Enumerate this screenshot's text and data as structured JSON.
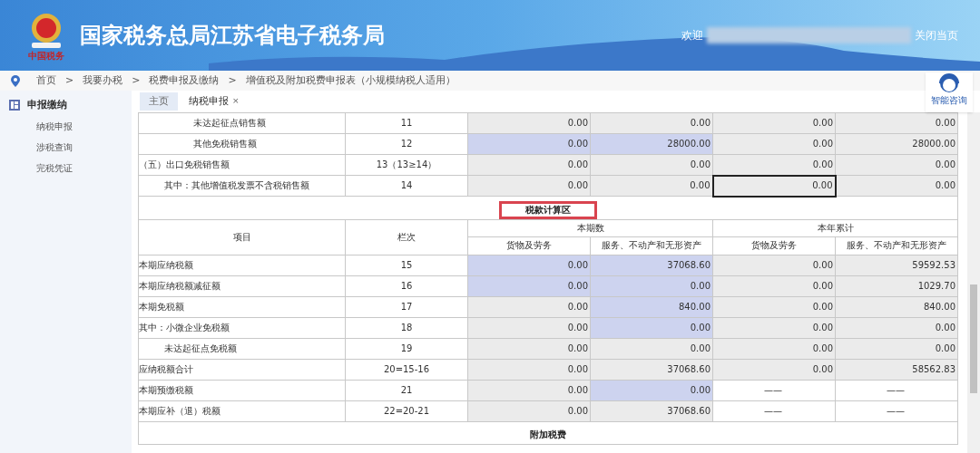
{
  "header": {
    "emblem_caption": "中国税务",
    "title": "国家税务总局江苏省电子税务局",
    "welcome": "欢迎",
    "close_page": "关闭当页"
  },
  "breadcrumb": {
    "separator": ">",
    "items": [
      "首页",
      "我要办税",
      "税费申报及缴纳",
      "增值税及附加税费申报表（小规模纳税人适用）"
    ]
  },
  "assistant": {
    "label": "智能咨询"
  },
  "sidebar": {
    "title": "申报缴纳",
    "items": [
      {
        "label": "纳税申报",
        "selected": false
      },
      {
        "label": "涉税查询",
        "selected": false
      },
      {
        "label": "完税凭证",
        "selected": false
      }
    ]
  },
  "tabs": [
    {
      "label": "主页",
      "selected": false
    },
    {
      "label": "纳税申报",
      "selected": true,
      "close": "×"
    }
  ],
  "upper_rows": [
    {
      "item": "未达起征点销售额",
      "kind": "deep",
      "line": "11",
      "cells": [
        {
          "text": "0.00",
          "kind": "computed",
          "focused": false
        },
        {
          "text": "0.00",
          "kind": "computed",
          "focused": false
        },
        {
          "text": "0.00",
          "kind": "computed",
          "focused": false
        },
        {
          "text": "0.00",
          "kind": "computed",
          "focused": false
        }
      ]
    },
    {
      "item": "其他免税销售额",
      "kind": "deep",
      "line": "12",
      "cells": [
        {
          "text": "0.00",
          "kind": "input",
          "focused": false
        },
        {
          "text": "28000.00",
          "kind": "input",
          "focused": false
        },
        {
          "text": "0.00",
          "kind": "computed",
          "focused": false
        },
        {
          "text": "28000.00",
          "kind": "computed",
          "focused": false
        }
      ]
    },
    {
      "item": "（五）出口免税销售额",
      "kind": "plain",
      "line": "13（13≥14）",
      "cells": [
        {
          "text": "0.00",
          "kind": "computed",
          "focused": false
        },
        {
          "text": "0.00",
          "kind": "computed",
          "focused": false
        },
        {
          "text": "0.00",
          "kind": "computed",
          "focused": false
        },
        {
          "text": "0.00",
          "kind": "computed",
          "focused": false
        }
      ]
    },
    {
      "item": "其中：其他增值税发票不含税销售额",
      "kind": "indent",
      "line": "14",
      "cells": [
        {
          "text": "0.00",
          "kind": "computed",
          "focused": false
        },
        {
          "text": "0.00",
          "kind": "computed",
          "focused": false
        },
        {
          "text": "0.00",
          "kind": "computed",
          "focused": true
        },
        {
          "text": "0.00",
          "kind": "computed",
          "focused": false
        }
      ]
    }
  ],
  "section": {
    "title": "税款计算区",
    "highlighted": true
  },
  "columns": {
    "item": "项目",
    "line": "栏次",
    "groups": [
      "本期数",
      "本年累计"
    ],
    "subs": [
      "货物及劳务",
      "服务、不动产和无形资产",
      "货物及劳务",
      "服务、不动产和无形资产"
    ]
  },
  "rows": [
    {
      "item": "本期应纳税额",
      "kind": "plain",
      "line": "15",
      "cells": [
        {
          "text": "0.00",
          "kind": "input",
          "focused": false
        },
        {
          "text": "37068.60",
          "kind": "input",
          "focused": false
        },
        {
          "text": "0.00",
          "kind": "computed",
          "focused": false
        },
        {
          "text": "59592.53",
          "kind": "computed",
          "focused": false
        }
      ]
    },
    {
      "item": "本期应纳税额减征额",
      "kind": "plain",
      "line": "16",
      "cells": [
        {
          "text": "0.00",
          "kind": "input",
          "focused": false
        },
        {
          "text": "0.00",
          "kind": "input",
          "focused": false
        },
        {
          "text": "0.00",
          "kind": "computed",
          "focused": false
        },
        {
          "text": "1029.70",
          "kind": "computed",
          "focused": false
        }
      ]
    },
    {
      "item": "本期免税额",
      "kind": "plain",
      "line": "17",
      "cells": [
        {
          "text": "0.00",
          "kind": "computed",
          "focused": false
        },
        {
          "text": "840.00",
          "kind": "input",
          "focused": false
        },
        {
          "text": "0.00",
          "kind": "computed",
          "focused": false
        },
        {
          "text": "840.00",
          "kind": "computed",
          "focused": false
        }
      ]
    },
    {
      "item": "其中：小微企业免税额",
      "kind": "plain",
      "line": "18",
      "cells": [
        {
          "text": "0.00",
          "kind": "computed",
          "focused": false
        },
        {
          "text": "0.00",
          "kind": "input",
          "focused": false
        },
        {
          "text": "0.00",
          "kind": "computed",
          "focused": false
        },
        {
          "text": "0.00",
          "kind": "computed",
          "focused": false
        }
      ]
    },
    {
      "item": "未达起征点免税额",
      "kind": "indent",
      "line": "19",
      "cells": [
        {
          "text": "0.00",
          "kind": "computed",
          "focused": false
        },
        {
          "text": "0.00",
          "kind": "computed",
          "focused": false
        },
        {
          "text": "0.00",
          "kind": "computed",
          "focused": false
        },
        {
          "text": "0.00",
          "kind": "computed",
          "focused": false
        }
      ]
    },
    {
      "item": "应纳税额合计",
      "kind": "plain",
      "line": "20=15-16",
      "cells": [
        {
          "text": "0.00",
          "kind": "computed",
          "focused": false
        },
        {
          "text": "37068.60",
          "kind": "computed",
          "focused": false
        },
        {
          "text": "0.00",
          "kind": "computed",
          "focused": false
        },
        {
          "text": "58562.83",
          "kind": "computed",
          "focused": false
        }
      ]
    },
    {
      "item": "本期预缴税额",
      "kind": "plain",
      "line": "21",
      "cells": [
        {
          "text": "0.00",
          "kind": "computed",
          "focused": false
        },
        {
          "text": "0.00",
          "kind": "input",
          "focused": false
        },
        {
          "text": "——",
          "kind": "none",
          "focused": false
        },
        {
          "text": "——",
          "kind": "none",
          "focused": false
        }
      ]
    },
    {
      "item": "本期应补（退）税额",
      "kind": "plain",
      "line": "22=20-21",
      "cells": [
        {
          "text": "0.00",
          "kind": "computed",
          "focused": false
        },
        {
          "text": "37068.60",
          "kind": "computed",
          "focused": false
        },
        {
          "text": "——",
          "kind": "none",
          "focused": false
        },
        {
          "text": "——",
          "kind": "none",
          "focused": false
        }
      ]
    }
  ],
  "next_section": {
    "title": "附加税费"
  }
}
